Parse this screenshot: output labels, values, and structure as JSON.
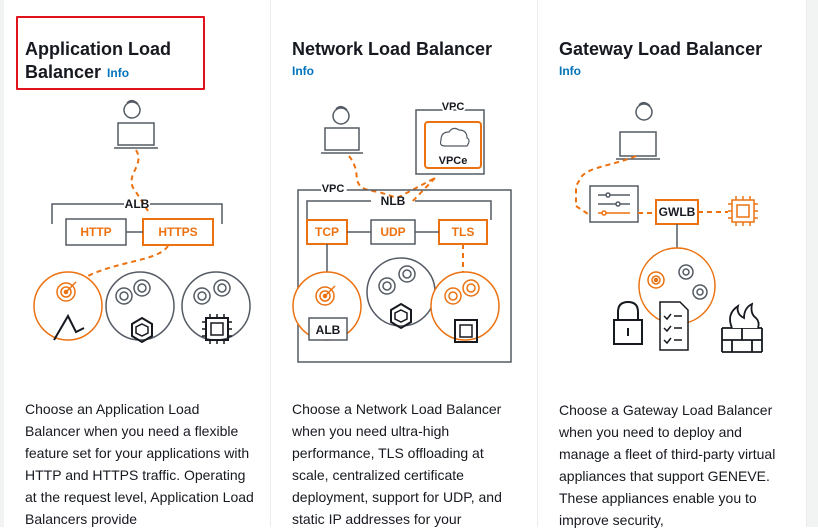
{
  "cards": [
    {
      "title": "Application Load Balancer",
      "info": "Info",
      "diagram": {
        "frame": "ALB",
        "boxes": [
          "HTTP",
          "HTTPS"
        ]
      },
      "description": "Choose an Application Load Balancer when you need a flexible feature set for your applications with HTTP and HTTPS traffic. Operating at the request level, Application Load Balancers provide"
    },
    {
      "title": "Network Load Balancer",
      "info": "Info",
      "diagram": {
        "vpc": "VPC",
        "vpce": "VPCe",
        "frame": "NLB",
        "boxes": [
          "TCP",
          "UDP",
          "TLS"
        ],
        "target": "ALB"
      },
      "description": "Choose a Network Load Balancer when you need ultra-high performance, TLS offloading at scale, centralized certificate deployment, support for UDP, and static IP addresses for your"
    },
    {
      "title": "Gateway Load Balancer",
      "info": "Info",
      "diagram": {
        "box": "GWLB"
      },
      "description": "Choose a Gateway Load Balancer when you need to deploy and manage a fleet of third-party virtual appliances that support GENEVE. These appliances enable you to improve security,"
    }
  ],
  "colors": {
    "accent": "#ec7211",
    "link": "#0073bb",
    "selection": "#e0121b",
    "text": "#16191f"
  }
}
